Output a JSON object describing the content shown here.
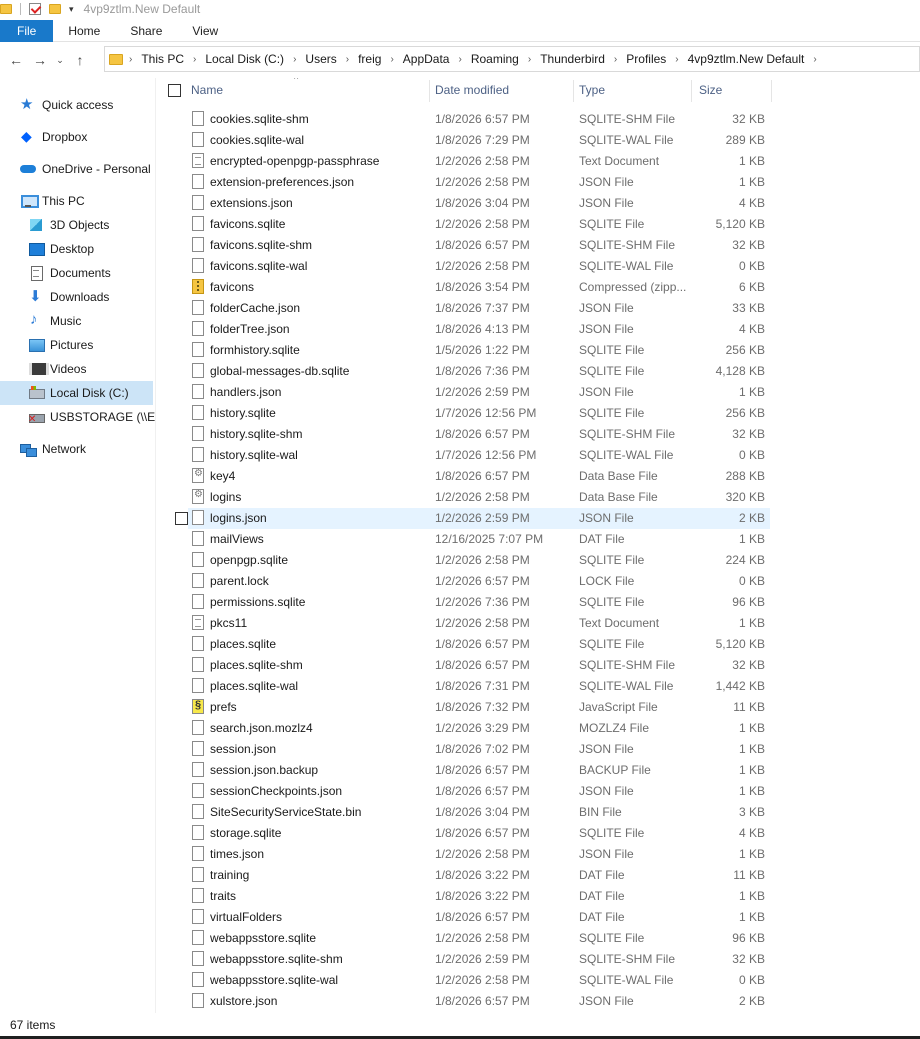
{
  "window": {
    "title": "4vp9ztlm.New Default"
  },
  "ribbon": {
    "tabs": [
      "File",
      "Home",
      "Share",
      "View"
    ]
  },
  "address": {
    "crumbs": [
      "This PC",
      "Local Disk (C:)",
      "Users",
      "freig",
      "AppData",
      "Roaming",
      "Thunderbird",
      "Profiles",
      "4vp9ztlm.New Default"
    ]
  },
  "sidebar": {
    "items": [
      {
        "label": "Quick access",
        "icon": "star-icon"
      },
      {
        "label": "Dropbox",
        "icon": "dropbox-icon"
      },
      {
        "label": "OneDrive - Personal",
        "icon": "cloud-icon"
      },
      {
        "label": "This PC",
        "icon": "computer-icon"
      },
      {
        "label": "3D Objects",
        "icon": "cube-icon"
      },
      {
        "label": "Desktop",
        "icon": "desktop-icon"
      },
      {
        "label": "Documents",
        "icon": "documents-icon"
      },
      {
        "label": "Downloads",
        "icon": "download-icon"
      },
      {
        "label": "Music",
        "icon": "music-icon"
      },
      {
        "label": "Pictures",
        "icon": "pictures-icon"
      },
      {
        "label": "Videos",
        "icon": "videos-icon"
      },
      {
        "label": "Local Disk (C:)",
        "icon": "disk-icon"
      },
      {
        "label": "USBSTORAGE (\\\\EPS",
        "icon": "usb-icon"
      },
      {
        "label": "Network",
        "icon": "network-icon"
      }
    ],
    "selected_color": "#cce4f7"
  },
  "columns": {
    "name": "Name",
    "date": "Date modified",
    "type": "Type",
    "size": "Size"
  },
  "files": [
    {
      "name": "cookies.sqlite-shm",
      "date": "1/8/2026 6:57 PM",
      "type": "SQLITE-SHM File",
      "size": "32 KB",
      "icon": "file-icon"
    },
    {
      "name": "cookies.sqlite-wal",
      "date": "1/8/2026 7:29 PM",
      "type": "SQLITE-WAL File",
      "size": "289 KB",
      "icon": "file-icon"
    },
    {
      "name": "encrypted-openpgp-passphrase",
      "date": "1/2/2026 2:58 PM",
      "type": "Text Document",
      "size": "1 KB",
      "icon": "text-file-icon"
    },
    {
      "name": "extension-preferences.json",
      "date": "1/2/2026 2:58 PM",
      "type": "JSON File",
      "size": "1 KB",
      "icon": "file-icon"
    },
    {
      "name": "extensions.json",
      "date": "1/8/2026 3:04 PM",
      "type": "JSON File",
      "size": "4 KB",
      "icon": "file-icon"
    },
    {
      "name": "favicons.sqlite",
      "date": "1/2/2026 2:58 PM",
      "type": "SQLITE File",
      "size": "5,120 KB",
      "icon": "file-icon"
    },
    {
      "name": "favicons.sqlite-shm",
      "date": "1/8/2026 6:57 PM",
      "type": "SQLITE-SHM File",
      "size": "32 KB",
      "icon": "file-icon"
    },
    {
      "name": "favicons.sqlite-wal",
      "date": "1/2/2026 2:58 PM",
      "type": "SQLITE-WAL File",
      "size": "0 KB",
      "icon": "file-icon"
    },
    {
      "name": "favicons",
      "date": "1/8/2026 3:54 PM",
      "type": "Compressed (zipp...",
      "size": "6 KB",
      "icon": "zip-file-icon"
    },
    {
      "name": "folderCache.json",
      "date": "1/8/2026 7:37 PM",
      "type": "JSON File",
      "size": "33 KB",
      "icon": "file-icon"
    },
    {
      "name": "folderTree.json",
      "date": "1/8/2026 4:13 PM",
      "type": "JSON File",
      "size": "4 KB",
      "icon": "file-icon"
    },
    {
      "name": "formhistory.sqlite",
      "date": "1/5/2026 1:22 PM",
      "type": "SQLITE File",
      "size": "256 KB",
      "icon": "file-icon"
    },
    {
      "name": "global-messages-db.sqlite",
      "date": "1/8/2026 7:36 PM",
      "type": "SQLITE File",
      "size": "4,128 KB",
      "icon": "file-icon"
    },
    {
      "name": "handlers.json",
      "date": "1/2/2026 2:59 PM",
      "type": "JSON File",
      "size": "1 KB",
      "icon": "file-icon"
    },
    {
      "name": "history.sqlite",
      "date": "1/7/2026 12:56 PM",
      "type": "SQLITE File",
      "size": "256 KB",
      "icon": "file-icon"
    },
    {
      "name": "history.sqlite-shm",
      "date": "1/8/2026 6:57 PM",
      "type": "SQLITE-SHM File",
      "size": "32 KB",
      "icon": "file-icon"
    },
    {
      "name": "history.sqlite-wal",
      "date": "1/7/2026 12:56 PM",
      "type": "SQLITE-WAL File",
      "size": "0 KB",
      "icon": "file-icon"
    },
    {
      "name": "key4",
      "date": "1/8/2026 6:57 PM",
      "type": "Data Base File",
      "size": "288 KB",
      "icon": "database-file-icon"
    },
    {
      "name": "logins",
      "date": "1/2/2026 2:58 PM",
      "type": "Data Base File",
      "size": "320 KB",
      "icon": "database-file-icon"
    },
    {
      "name": "logins.json",
      "date": "1/2/2026 2:59 PM",
      "type": "JSON File",
      "size": "2 KB",
      "icon": "file-icon",
      "hover": true
    },
    {
      "name": "mailViews",
      "date": "12/16/2025 7:07 PM",
      "type": "DAT File",
      "size": "1 KB",
      "icon": "file-icon"
    },
    {
      "name": "openpgp.sqlite",
      "date": "1/2/2026 2:58 PM",
      "type": "SQLITE File",
      "size": "224 KB",
      "icon": "file-icon"
    },
    {
      "name": "parent.lock",
      "date": "1/2/2026 6:57 PM",
      "type": "LOCK File",
      "size": "0 KB",
      "icon": "file-icon"
    },
    {
      "name": "permissions.sqlite",
      "date": "1/2/2026 7:36 PM",
      "type": "SQLITE File",
      "size": "96 KB",
      "icon": "file-icon"
    },
    {
      "name": "pkcs11",
      "date": "1/2/2026 2:58 PM",
      "type": "Text Document",
      "size": "1 KB",
      "icon": "text-file-icon"
    },
    {
      "name": "places.sqlite",
      "date": "1/8/2026 6:57 PM",
      "type": "SQLITE File",
      "size": "5,120 KB",
      "icon": "file-icon"
    },
    {
      "name": "places.sqlite-shm",
      "date": "1/8/2026 6:57 PM",
      "type": "SQLITE-SHM File",
      "size": "32 KB",
      "icon": "file-icon"
    },
    {
      "name": "places.sqlite-wal",
      "date": "1/8/2026 7:31 PM",
      "type": "SQLITE-WAL File",
      "size": "1,442 KB",
      "icon": "file-icon"
    },
    {
      "name": "prefs",
      "date": "1/8/2026 7:32 PM",
      "type": "JavaScript File",
      "size": "11 KB",
      "icon": "javascript-file-icon"
    },
    {
      "name": "search.json.mozlz4",
      "date": "1/2/2026 3:29 PM",
      "type": "MOZLZ4 File",
      "size": "1 KB",
      "icon": "file-icon"
    },
    {
      "name": "session.json",
      "date": "1/8/2026 7:02 PM",
      "type": "JSON File",
      "size": "1 KB",
      "icon": "file-icon"
    },
    {
      "name": "session.json.backup",
      "date": "1/8/2026 6:57 PM",
      "type": "BACKUP File",
      "size": "1 KB",
      "icon": "file-icon"
    },
    {
      "name": "sessionCheckpoints.json",
      "date": "1/8/2026 6:57 PM",
      "type": "JSON File",
      "size": "1 KB",
      "icon": "file-icon"
    },
    {
      "name": "SiteSecurityServiceState.bin",
      "date": "1/8/2026 3:04 PM",
      "type": "BIN File",
      "size": "3 KB",
      "icon": "file-icon"
    },
    {
      "name": "storage.sqlite",
      "date": "1/8/2026 6:57 PM",
      "type": "SQLITE File",
      "size": "4 KB",
      "icon": "file-icon"
    },
    {
      "name": "times.json",
      "date": "1/2/2026 2:58 PM",
      "type": "JSON File",
      "size": "1 KB",
      "icon": "file-icon"
    },
    {
      "name": "training",
      "date": "1/8/2026 3:22 PM",
      "type": "DAT File",
      "size": "11 KB",
      "icon": "file-icon"
    },
    {
      "name": "traits",
      "date": "1/8/2026 3:22 PM",
      "type": "DAT File",
      "size": "1 KB",
      "icon": "file-icon"
    },
    {
      "name": "virtualFolders",
      "date": "1/8/2026 6:57 PM",
      "type": "DAT File",
      "size": "1 KB",
      "icon": "file-icon"
    },
    {
      "name": "webappsstore.sqlite",
      "date": "1/2/2026 2:58 PM",
      "type": "SQLITE File",
      "size": "96 KB",
      "icon": "file-icon"
    },
    {
      "name": "webappsstore.sqlite-shm",
      "date": "1/2/2026 2:59 PM",
      "type": "SQLITE-SHM File",
      "size": "32 KB",
      "icon": "file-icon"
    },
    {
      "name": "webappsstore.sqlite-wal",
      "date": "1/2/2026 2:58 PM",
      "type": "SQLITE-WAL File",
      "size": "0 KB",
      "icon": "file-icon"
    },
    {
      "name": "xulstore.json",
      "date": "1/8/2026 6:57 PM",
      "type": "JSON File",
      "size": "2 KB",
      "icon": "file-icon"
    }
  ],
  "status": {
    "item_count": "67 items"
  },
  "colors": {
    "file_tab": "#1979ca",
    "hover_row": "#e5f3ff",
    "header_text": "#4d6185"
  }
}
